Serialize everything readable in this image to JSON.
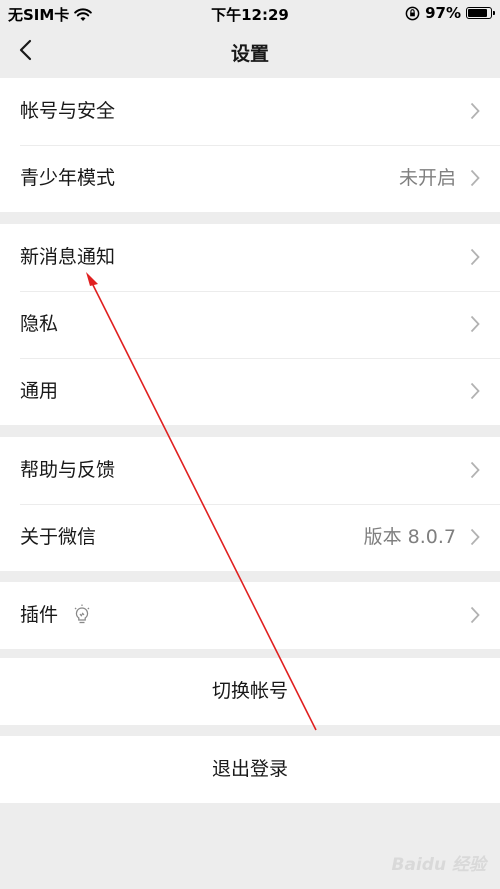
{
  "status_bar": {
    "carrier": "无SIM卡",
    "time": "下午12:29",
    "battery_percent": "97%",
    "battery_level": 0.97,
    "wifi_icon": "wifi-icon",
    "orientation_lock_icon": "orientation-lock-icon"
  },
  "nav": {
    "title": "设置",
    "back_icon": "chevron-left-icon"
  },
  "groups": [
    {
      "items": [
        {
          "label": "帐号与安全",
          "value": ""
        },
        {
          "label": "青少年模式",
          "value": "未开启"
        }
      ]
    },
    {
      "items": [
        {
          "label": "新消息通知",
          "value": ""
        },
        {
          "label": "隐私",
          "value": ""
        },
        {
          "label": "通用",
          "value": ""
        }
      ]
    },
    {
      "items": [
        {
          "label": "帮助与反馈",
          "value": ""
        },
        {
          "label": "关于微信",
          "value": "版本 8.0.7"
        }
      ]
    },
    {
      "items": [
        {
          "label": "插件",
          "value": "",
          "icon": "lightbulb-icon"
        }
      ]
    }
  ],
  "actions": {
    "switch_account": "切换帐号",
    "logout": "退出登录"
  },
  "annotation": {
    "type": "red-arrow",
    "color": "#e02020"
  },
  "watermark": "Baidu 经验",
  "colors": {
    "background": "#ededed",
    "cell": "#ffffff",
    "secondary_text": "#7f7f7f",
    "chevron": "#b2b2b2"
  }
}
